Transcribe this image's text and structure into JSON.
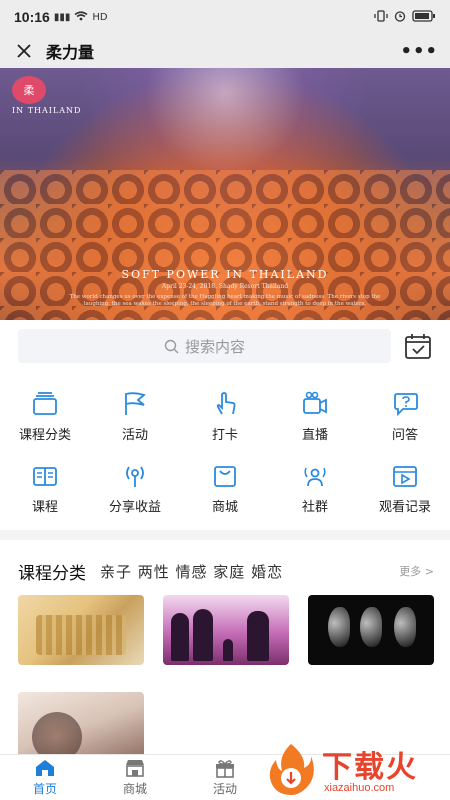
{
  "status": {
    "time": "10:16",
    "network": "HD"
  },
  "titlebar": {
    "title": "柔力量",
    "more": "•••"
  },
  "banner": {
    "logo": "柔",
    "logo_sub": "IN THAILAND",
    "headline": "SOFT POWER IN THAILAND",
    "date": "April 23-24, 2018. Shady Resort Thailand",
    "motto": "The world changes us over the expense of the Haggling heart making the music of sadness. The rivers stop the laughing, the sea wakes the sleeping, the sleeping of the earth, stand strength to deep in the waters."
  },
  "search": {
    "placeholder": "搜索内容"
  },
  "grid": {
    "items": [
      {
        "label": "课程分类",
        "icon": "folder-icon"
      },
      {
        "label": "活动",
        "icon": "flag-icon"
      },
      {
        "label": "打卡",
        "icon": "tap-icon"
      },
      {
        "label": "直播",
        "icon": "video-camera-icon"
      },
      {
        "label": "问答",
        "icon": "question-chat-icon"
      },
      {
        "label": "课程",
        "icon": "book-icon"
      },
      {
        "label": "分享收益",
        "icon": "broadcast-icon"
      },
      {
        "label": "商城",
        "icon": "shopping-bag-icon"
      },
      {
        "label": "社群",
        "icon": "community-icon"
      },
      {
        "label": "观看记录",
        "icon": "play-history-icon"
      }
    ]
  },
  "section": {
    "title": "课程分类",
    "tags": "亲子 两性 情感 家庭 婚恋",
    "more": "更多 >"
  },
  "tabbar": {
    "items": [
      {
        "label": "首页",
        "active": true
      },
      {
        "label": "商城",
        "active": false
      },
      {
        "label": "活动",
        "active": false
      }
    ]
  },
  "watermark": {
    "cn": "下载火",
    "en": "xiazaihuo.com"
  },
  "colors": {
    "accent": "#1c7fd8",
    "icon_blue": "#2a8ae0",
    "watermark": "#e8432c"
  }
}
